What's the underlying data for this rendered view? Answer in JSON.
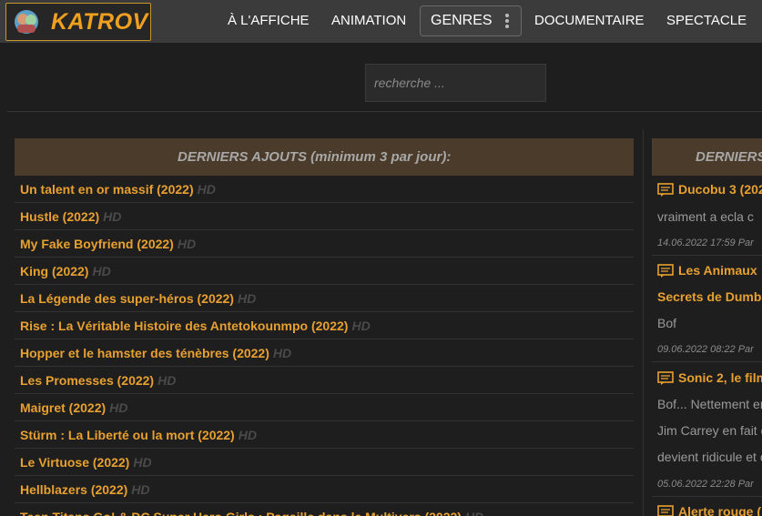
{
  "header": {
    "logo_text": "KATROV",
    "nav": [
      {
        "label": "À L'AFFICHE"
      },
      {
        "label": "ANIMATION"
      },
      {
        "label": "GENRES"
      },
      {
        "label": "DOCUMENTAIRE"
      },
      {
        "label": "SPECTACLE"
      }
    ]
  },
  "search": {
    "placeholder": "recherche ..."
  },
  "left_panel": {
    "title": "DERNIERS AJOUTS",
    "subtitle": "(minimum 3 par jour):",
    "items": [
      {
        "title": "Un talent en or massif (2022)",
        "badge": "HD"
      },
      {
        "title": "Hustle (2022)",
        "badge": "HD"
      },
      {
        "title": "My Fake Boyfriend (2022)",
        "badge": "HD"
      },
      {
        "title": "King (2022)",
        "badge": "HD"
      },
      {
        "title": "La Légende des super-héros (2022)",
        "badge": "HD"
      },
      {
        "title": "Rise : La Véritable Histoire des Antetokounmpo (2022)",
        "badge": "HD"
      },
      {
        "title": "Hopper et le hamster des ténèbres (2022)",
        "badge": "HD"
      },
      {
        "title": "Les Promesses (2022)",
        "badge": "HD"
      },
      {
        "title": "Maigret (2022)",
        "badge": "HD"
      },
      {
        "title": "Stürm : La Liberté ou la mort (2022)",
        "badge": "HD"
      },
      {
        "title": "Le Virtuose (2022)",
        "badge": "HD"
      },
      {
        "title": "Hellblazers (2022)",
        "badge": "HD"
      },
      {
        "title": "Teen Titans Go! & DC Super Hero Girls : Pagaille dans le Multivers (2022)",
        "badge": "HD"
      }
    ]
  },
  "right_panel": {
    "title": "DERNIERS",
    "comments": [
      {
        "title": "Ducobu 3 (202",
        "text_lines": [
          "vraiment a ecla c"
        ],
        "meta": "14.06.2022 17:59 Par"
      },
      {
        "title": "Les Animaux",
        "title_line2": "Secrets de Dumb",
        "text_lines": [
          "Bof"
        ],
        "meta": "09.06.2022 08:22 Par"
      },
      {
        "title": "Sonic 2, le film",
        "text_lines": [
          "Bof... Nettement er",
          "Jim Carrey en fait d",
          "devient ridicule et c"
        ],
        "meta": "05.06.2022 22:28 Par"
      },
      {
        "title": "Alerte rouge ("
      }
    ]
  },
  "colors": {
    "accent": "#e8a030",
    "header_bg": "#3b3b3b",
    "panel_head_bg": "#4a3b2a"
  }
}
